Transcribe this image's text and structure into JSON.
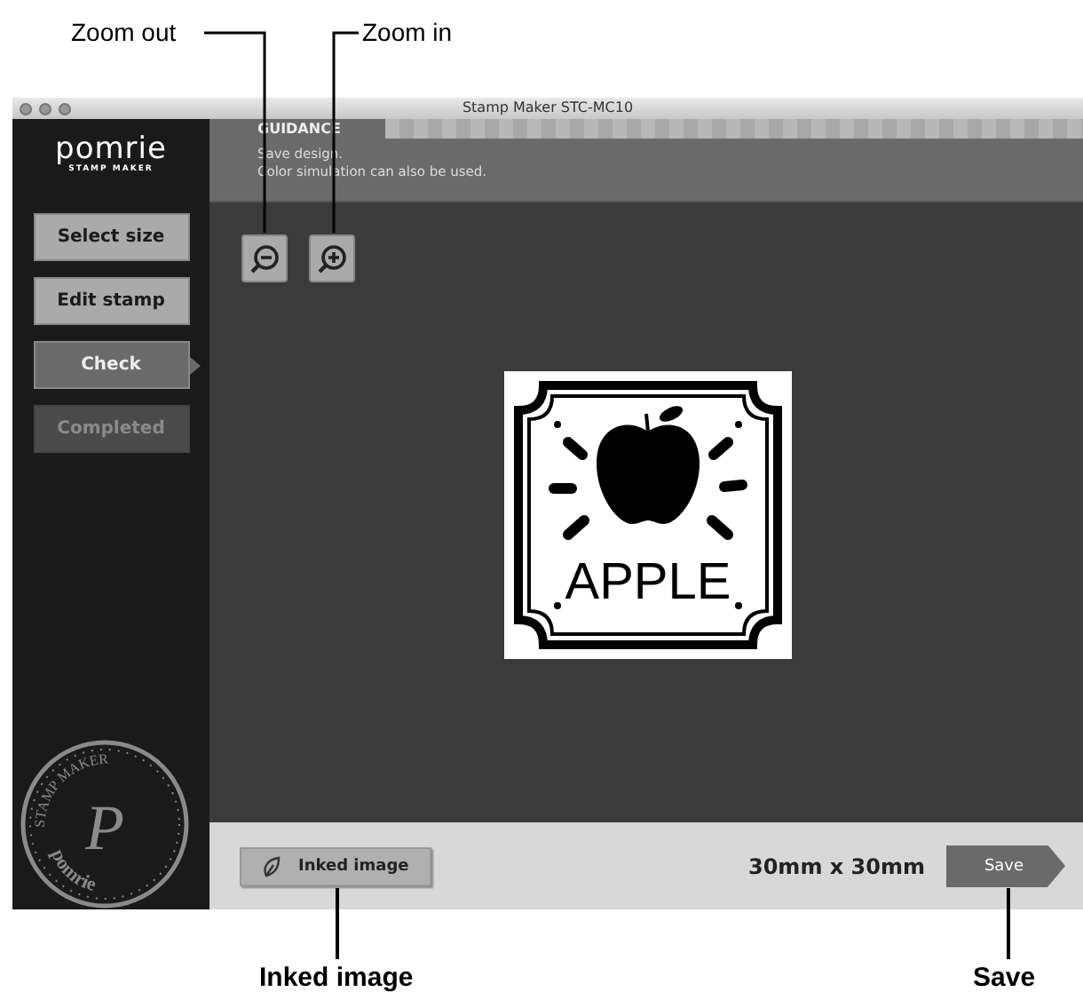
{
  "callouts": [
    {
      "label": "Zoom out"
    },
    {
      "label": "Zoom in"
    },
    {
      "label": "Inked image"
    },
    {
      "label": "Save"
    }
  ],
  "window": {
    "title": "Stamp Maker STC-MC10"
  },
  "sidebar": {
    "logo": "pomrie",
    "logo_sub": "STAMP MAKER",
    "items": [
      {
        "label": "Select size",
        "selected": false,
        "disabled": false
      },
      {
        "label": "Edit stamp",
        "selected": false,
        "disabled": false
      },
      {
        "label": "Check",
        "selected": true,
        "disabled": false
      },
      {
        "label": "Completed",
        "selected": false,
        "disabled": true
      }
    ],
    "seal": {
      "top": "STAMP MAKER",
      "monogram": "P",
      "bottom": "pomrie"
    }
  },
  "guidance": {
    "heading": "GUIDANCE",
    "lines": [
      "Save design.",
      "Color simulation can also be used."
    ]
  },
  "stamp": {
    "text": "APPLE"
  },
  "bottom_bar": {
    "inked_button": "Inked image",
    "size": "30mm x 30mm",
    "save_button": "Save"
  }
}
